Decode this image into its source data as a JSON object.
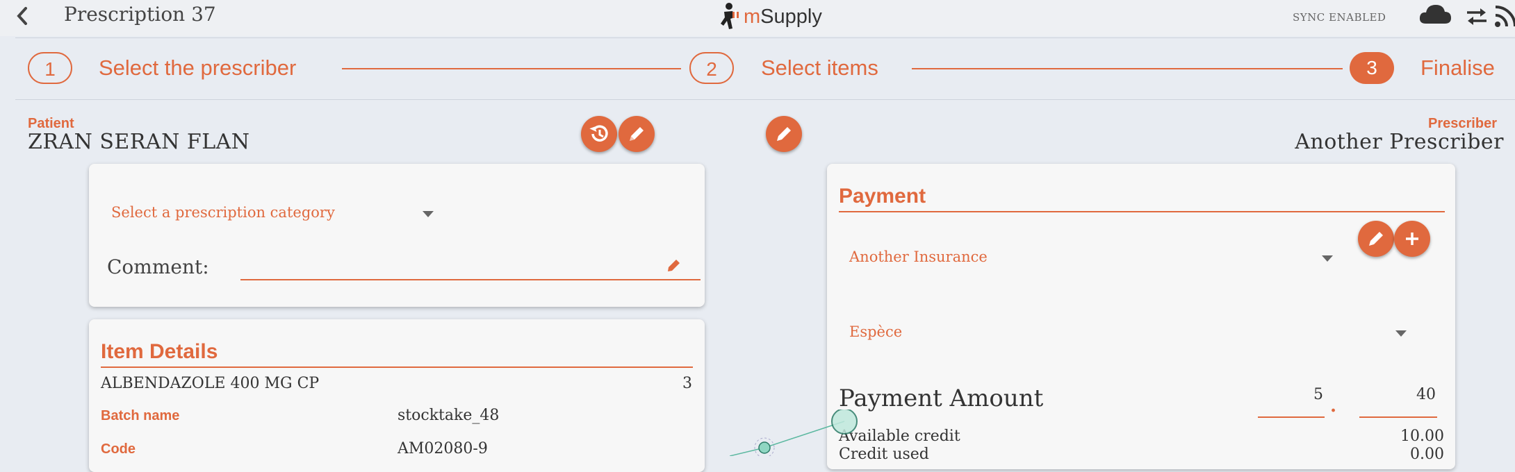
{
  "header": {
    "title": "Prescription 37",
    "brand_initial": "m",
    "brand_rest": "Supply",
    "sync_status": "SYNC ENABLED"
  },
  "stepper": {
    "steps": [
      {
        "number": "1",
        "label": "Select the prescriber"
      },
      {
        "number": "2",
        "label": "Select items"
      },
      {
        "number": "3",
        "label": "Finalise"
      }
    ],
    "active_step": 3
  },
  "patient": {
    "label": "Patient",
    "name": "ZRAN SERAN FLAN"
  },
  "prescriber": {
    "label": "Prescriber",
    "name": "Another Prescriber"
  },
  "prescription": {
    "category_placeholder": "Select a prescription category",
    "comment_label": "Comment:",
    "comment_value": ""
  },
  "item_details": {
    "title": "Item Details",
    "item_name": "ALBENDAZOLE 400 MG CP",
    "quantity": "3",
    "rows": [
      {
        "key": "Batch name",
        "value": "stocktake_48"
      },
      {
        "key": "Code",
        "value": "AM02080-9"
      }
    ]
  },
  "payment": {
    "title": "Payment",
    "insurance": "Another Insurance",
    "payment_type": "Espèce",
    "amount_label": "Payment Amount",
    "amount_whole": "5",
    "amount_separator": ".",
    "amount_cents": "40",
    "available_credit_label": "Available credit",
    "available_credit_value": "10.00",
    "credit_used_label": "Credit used",
    "credit_used_value": "0.00"
  },
  "colors": {
    "accent": "#e0693e",
    "background": "#e8ecf2",
    "card": "#f7f7f7"
  }
}
